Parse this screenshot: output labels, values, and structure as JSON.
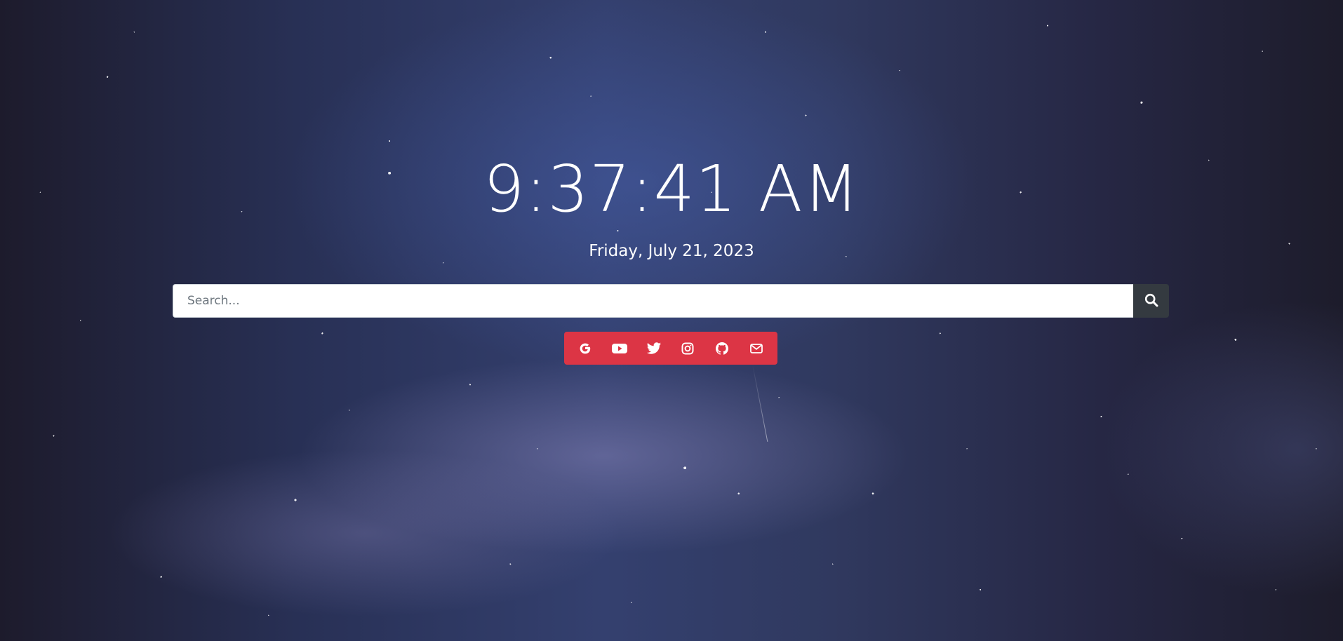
{
  "clock": {
    "time": "9:37:41 AM",
    "date": "Friday, July 21, 2023"
  },
  "search": {
    "placeholder": "Search...",
    "value": "",
    "button_icon": "search-icon"
  },
  "links": {
    "background_color": "#dc3545",
    "items": [
      {
        "icon": "google-icon"
      },
      {
        "icon": "youtube-icon"
      },
      {
        "icon": "twitter-icon"
      },
      {
        "icon": "instagram-icon"
      },
      {
        "icon": "github-icon"
      },
      {
        "icon": "mail-icon"
      }
    ]
  },
  "colors": {
    "search_button": "#343a40",
    "text": "#ffffff"
  }
}
